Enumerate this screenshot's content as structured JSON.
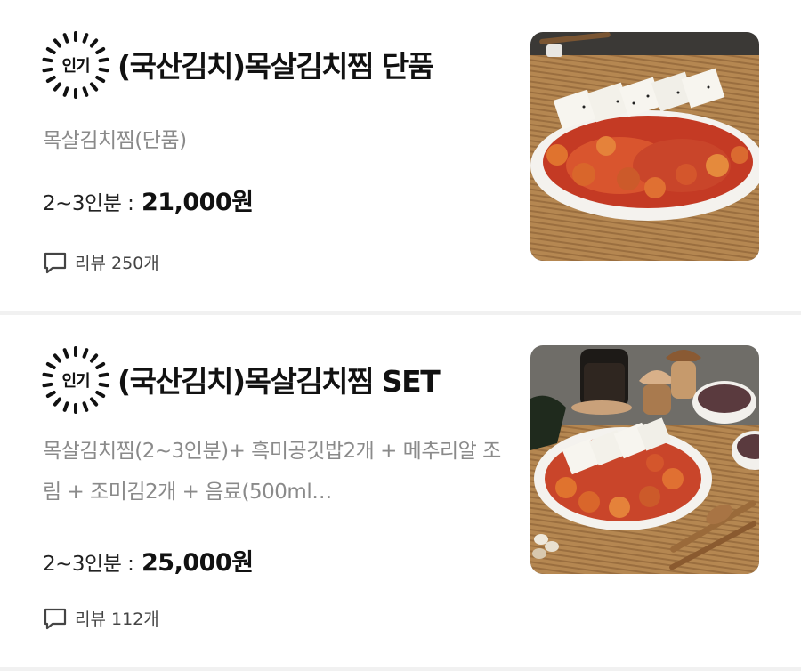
{
  "items": [
    {
      "badge": "인기",
      "title": "(국산김치)목살김치찜 단품",
      "description": "목살김치찜(단품)",
      "price_label": "2~3인분 :",
      "price": "21,000원",
      "review_label": "리뷰 250개"
    },
    {
      "badge": "인기",
      "title": "(국산김치)목살김치찜 SET",
      "description": "목살김치찜(2~3인분)+ 흑미공깃밥2개 + 메추리알 조림 + 조미김2개 + 음료(500ml…",
      "price_label": "2~3인분 :",
      "price": "25,000원",
      "review_label": "리뷰 112개"
    }
  ],
  "colors": {
    "badge_dashes": "#111111",
    "description": "#8a8a8a",
    "divider": "#f1f1f1",
    "sauce": "#d9442b",
    "tofu": "#f7f5ef",
    "mat": "#b98a52"
  },
  "icons": {
    "badge": "popular-sunburst-icon",
    "review": "speech-bubble-icon"
  }
}
